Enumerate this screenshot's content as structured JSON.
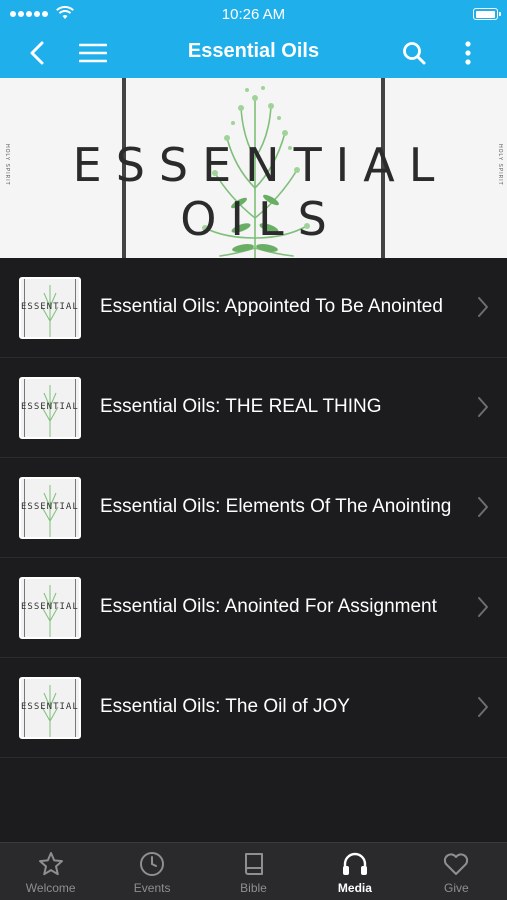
{
  "status_bar": {
    "time": "10:26 AM"
  },
  "nav": {
    "title": "Essential Oils",
    "back_icon": "chevron-left-icon",
    "menu_icon": "hamburger-icon",
    "search_icon": "search-icon",
    "more_icon": "more-vertical-icon"
  },
  "banner": {
    "title": "ESSENTIAL OILS",
    "side_text": "HOLY SPIRIT"
  },
  "thumb_text": "ESSENTIAL OILS",
  "items": [
    {
      "title": "Essential Oils: Appointed To Be Anointed"
    },
    {
      "title": "Essential Oils: THE REAL THING"
    },
    {
      "title": "Essential Oils: Elements Of The Anointing"
    },
    {
      "title": "Essential Oils: Anointed For Assignment"
    },
    {
      "title": "Essential Oils: The Oil of JOY"
    }
  ],
  "tabs": [
    {
      "label": "Welcome",
      "icon": "star-icon",
      "active": false
    },
    {
      "label": "Events",
      "icon": "clock-icon",
      "active": false
    },
    {
      "label": "Bible",
      "icon": "book-icon",
      "active": false
    },
    {
      "label": "Media",
      "icon": "headphones-icon",
      "active": true
    },
    {
      "label": "Give",
      "icon": "heart-icon",
      "active": false
    }
  ],
  "colors": {
    "accent": "#1fb0ec",
    "background": "#1c1c1e",
    "tab_bar": "#2a2a2c",
    "plant": "#7fbf7a"
  }
}
